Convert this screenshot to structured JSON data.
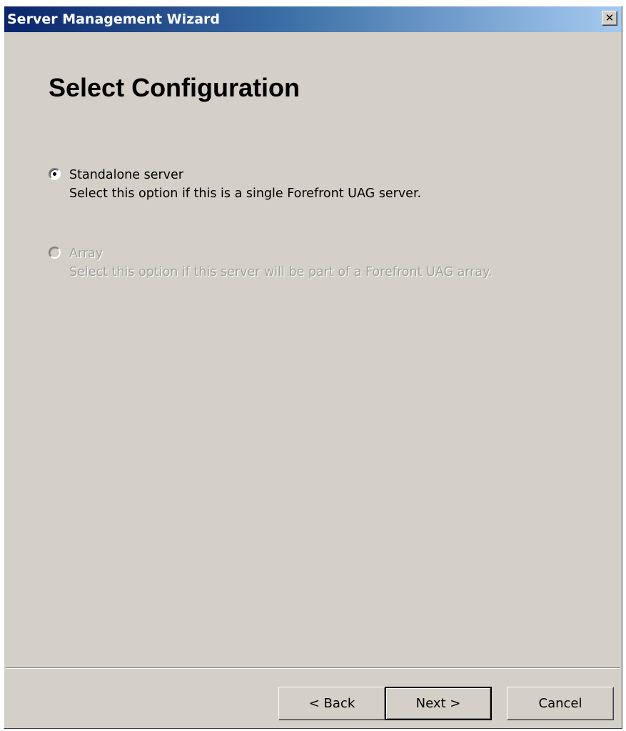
{
  "window": {
    "title": "Server Management Wizard",
    "close_symbol": "✕",
    "close_icon": "close-icon"
  },
  "page": {
    "title": "Select Configuration"
  },
  "options": [
    {
      "label": "Standalone server",
      "description": "Select this option if this is a single Forefront UAG server.",
      "selected": true,
      "enabled": true
    },
    {
      "label": "Array",
      "description": "Select this option if this server will be part of a Forefront UAG array.",
      "selected": false,
      "enabled": false
    }
  ],
  "buttons": {
    "back": "< Back",
    "next": "Next >",
    "cancel": "Cancel"
  },
  "colors": {
    "titlebar_start": "#0a246a",
    "titlebar_end": "#a6caf0",
    "dialog_background": "#d4d0c8",
    "disabled_text": "#a0a0a0"
  }
}
